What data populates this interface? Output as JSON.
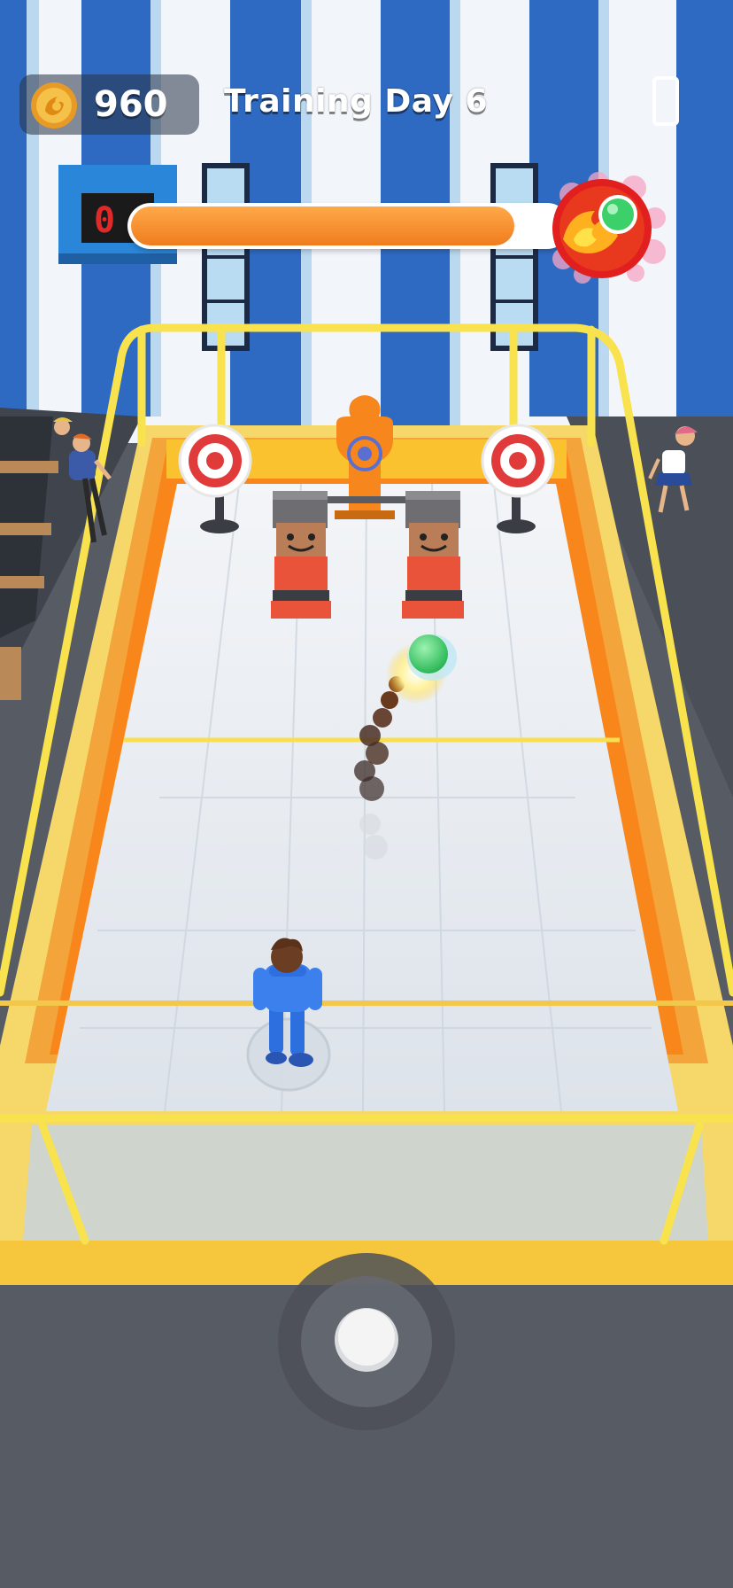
{
  "hud": {
    "coins": "960",
    "coin_icon": "coin-icon",
    "level_title": "Training Day 6",
    "device_icon": "phone-icon"
  },
  "progress": {
    "fraction": 0.88,
    "icon": "fireball-icon",
    "fill_color": "#f5861f"
  },
  "scoreboard": {
    "digits": "0"
  },
  "controls": {
    "joystick_icon": "joystick-icon"
  },
  "colors": {
    "accent_orange": "#f5861f",
    "rail_yellow": "#f5d23a",
    "court_floor": "#e8edf3",
    "player_blue": "#2e6fe0"
  }
}
